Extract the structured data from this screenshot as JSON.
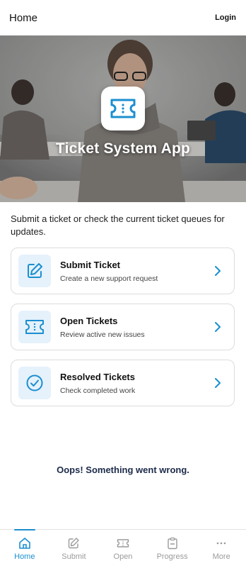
{
  "header": {
    "title": "Home",
    "login_label": "Login"
  },
  "hero": {
    "app_title": "Ticket System App",
    "logo_icon": "ticket-icon"
  },
  "intro_text": "Submit a ticket or check the current ticket queues for updates.",
  "cards": [
    {
      "title": "Submit Ticket",
      "subtitle": "Create a new support request",
      "icon": "edit-icon"
    },
    {
      "title": "Open Tickets",
      "subtitle": "Review active new issues",
      "icon": "ticket-icon"
    },
    {
      "title": "Resolved Tickets",
      "subtitle": "Check completed work",
      "icon": "check-circle-icon"
    }
  ],
  "error_message": "Oops! Something went wrong.",
  "bottom_nav": [
    {
      "label": "Home",
      "icon": "home-icon",
      "active": true
    },
    {
      "label": "Submit",
      "icon": "edit-icon",
      "active": false
    },
    {
      "label": "Open",
      "icon": "ticket-icon",
      "active": false
    },
    {
      "label": "Progress",
      "icon": "clipboard-icon",
      "active": false
    },
    {
      "label": "More",
      "icon": "more-icon",
      "active": false
    }
  ],
  "colors": {
    "accent": "#1b8fd0",
    "icon_bg": "#e5f1fb",
    "error_text": "#1c2a4a"
  }
}
